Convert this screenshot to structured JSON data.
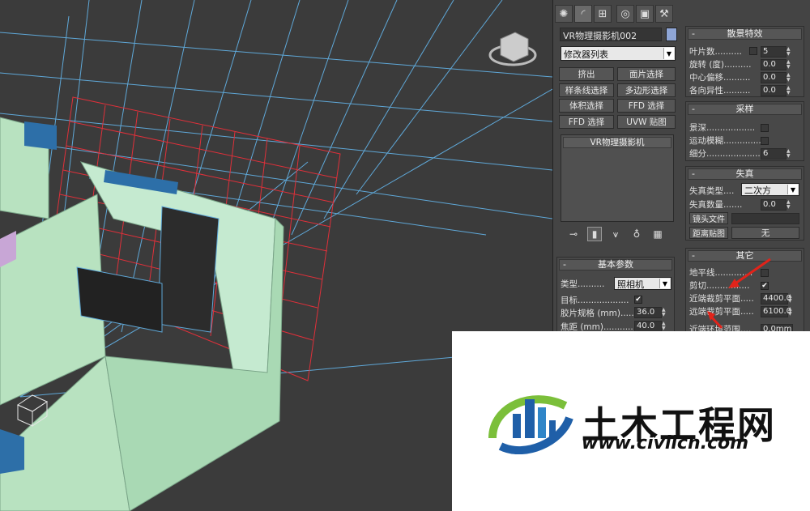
{
  "viewport": {
    "name": "3D perspective viewport"
  },
  "command_panel": {
    "tabs": [
      {
        "icon": "sun-icon"
      },
      {
        "icon": "curve-icon"
      },
      {
        "icon": "hierarchy-icon"
      },
      {
        "icon": "motion-icon"
      },
      {
        "icon": "display-icon"
      },
      {
        "icon": "hammer-icon"
      }
    ],
    "object_name": "VR物理摄影机002",
    "object_color": "#8fa6d6",
    "modifier_list": "修改器列表",
    "modifier_buttons": [
      "挤出",
      "面片选择",
      "样条线选择",
      "多边形选择",
      "体积选择",
      "FFD 选择",
      "FFD 选择",
      "UVW 贴图"
    ],
    "stack_items": [
      "VR物理摄影机"
    ],
    "stack_tools": [
      "pin-icon",
      "show-end-icon",
      "make-unique-icon",
      "remove-modifier-icon",
      "configure-icon"
    ]
  },
  "basic_params": {
    "title": "基本参数",
    "type_label": "类型",
    "type_value": "照相机",
    "target_label": "目标",
    "target_checked": "✔",
    "film_label": "胶片规格 (mm)",
    "film_value": "36.0",
    "focal_label": "焦距 (mm)",
    "focal_value": "40.0"
  },
  "bokeh": {
    "title": "散景特效",
    "rows": [
      {
        "label": "叶片数",
        "value": "5"
      },
      {
        "label": "旋转 (度)",
        "value": "0.0"
      },
      {
        "label": "中心偏移",
        "value": "0.0"
      },
      {
        "label": "各向异性",
        "value": "0.0"
      }
    ]
  },
  "sampling": {
    "title": "采样",
    "dof_label": "景深",
    "motion_blur_label": "运动模糊",
    "subdivs_label": "细分",
    "subdivs_value": "6"
  },
  "distortion": {
    "title": "失真",
    "type_label": "失真类型",
    "type_value": "二次方",
    "amount_label": "失真数量",
    "amount_value": "0.0",
    "lens_file_label": "镜头文件",
    "lens_file_value": "",
    "texture_label": "距离贴图",
    "texture_value": "无"
  },
  "misc": {
    "title": "其它",
    "horizon_label": "地平线",
    "clipping_label": "剪切",
    "clipping_checked": "✔",
    "near_clip_label": "近端裁剪平面",
    "near_clip_value": "4400.0",
    "far_clip_label": "远端裁剪平面",
    "far_clip_value": "6100.0",
    "near_env_label": "近端环境范围",
    "near_env_value": "0.0mm"
  },
  "watermark": {
    "title": "土木工程网",
    "url": "www.civilcn.com"
  },
  "colors": {
    "grid_blue": "#5fa8d8",
    "grid_red": "#e0303a",
    "wall_green": "#b8e2c0",
    "wall_blue": "#2d6fa8"
  }
}
